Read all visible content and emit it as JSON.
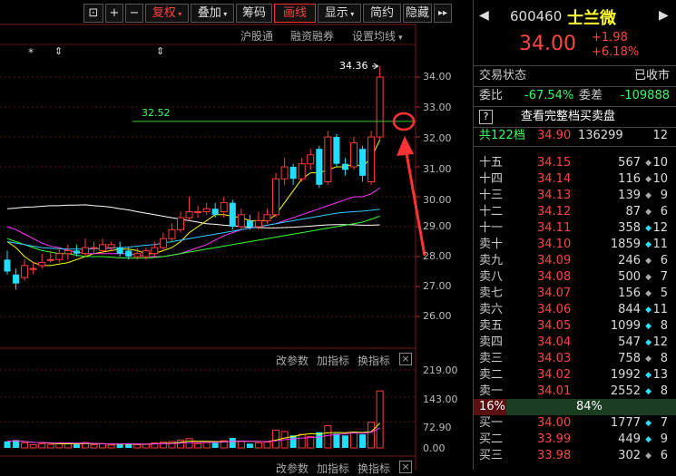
{
  "toolbar": {
    "items": [
      "⊡",
      "+",
      "−",
      "复权",
      "叠加",
      "筹码",
      "画线",
      "显示",
      "简约",
      "隐藏",
      "▸▸"
    ]
  },
  "subtoolbar": {
    "hugu": "沪股通",
    "rongzi": "融资融券",
    "set_ma": "设置均线",
    "caret": "▾"
  },
  "chart": {
    "markers": [
      "*",
      "⇕",
      "⇕"
    ],
    "high_label": "34.36",
    "hline_label": "32.52",
    "price_axis": [
      "34.00",
      "33.00",
      "32.00",
      "31.00",
      "30.00",
      "29.00",
      "28.00",
      "27.00",
      "26.00"
    ],
    "vol_axis": [
      "219.00",
      "143.00",
      "72.90",
      "0.00"
    ],
    "panel_buttons": [
      "改参数",
      "加指标",
      "换指标"
    ],
    "close_icon": "×"
  },
  "chart_data": {
    "type": "candlestick",
    "candles": [
      {
        "o": 27.9,
        "c": 27.5,
        "h": 28.2,
        "l": 27.4,
        "v": 18
      },
      {
        "o": 27.4,
        "c": 27.1,
        "h": 27.6,
        "l": 26.9,
        "v": 22
      },
      {
        "o": 27.3,
        "c": 27.7,
        "h": 27.9,
        "l": 27.2,
        "v": 14
      },
      {
        "o": 27.6,
        "c": 27.6,
        "h": 27.8,
        "l": 27.4,
        "v": 9
      },
      {
        "o": 27.7,
        "c": 27.8,
        "h": 28.1,
        "l": 27.6,
        "v": 12
      },
      {
        "o": 27.9,
        "c": 27.9,
        "h": 28.2,
        "l": 27.8,
        "v": 10
      },
      {
        "o": 27.9,
        "c": 28.1,
        "h": 28.3,
        "l": 27.8,
        "v": 14
      },
      {
        "o": 28.1,
        "c": 28.2,
        "h": 28.4,
        "l": 27.9,
        "v": 12
      },
      {
        "o": 28.2,
        "c": 28.1,
        "h": 28.4,
        "l": 28.0,
        "v": 10
      },
      {
        "o": 28.1,
        "c": 28.3,
        "h": 28.6,
        "l": 28.0,
        "v": 15
      },
      {
        "o": 28.3,
        "c": 28.3,
        "h": 28.5,
        "l": 28.1,
        "v": 9
      },
      {
        "o": 28.2,
        "c": 28.4,
        "h": 28.6,
        "l": 28.1,
        "v": 12
      },
      {
        "o": 28.3,
        "c": 28.4,
        "h": 28.5,
        "l": 28.2,
        "v": 8
      },
      {
        "o": 28.3,
        "c": 28.1,
        "h": 28.5,
        "l": 28.0,
        "v": 11
      },
      {
        "o": 28.2,
        "c": 28.0,
        "h": 28.3,
        "l": 27.9,
        "v": 13
      },
      {
        "o": 28.0,
        "c": 28.1,
        "h": 28.3,
        "l": 27.9,
        "v": 9
      },
      {
        "o": 28.0,
        "c": 28.2,
        "h": 28.3,
        "l": 27.9,
        "v": 10
      },
      {
        "o": 28.1,
        "c": 28.3,
        "h": 28.5,
        "l": 28.0,
        "v": 14
      },
      {
        "o": 28.3,
        "c": 28.6,
        "h": 28.8,
        "l": 28.2,
        "v": 16
      },
      {
        "o": 28.6,
        "c": 28.9,
        "h": 29.1,
        "l": 28.5,
        "v": 18
      },
      {
        "o": 28.9,
        "c": 29.3,
        "h": 29.5,
        "l": 28.8,
        "v": 22
      },
      {
        "o": 29.3,
        "c": 29.5,
        "h": 30.0,
        "l": 29.2,
        "v": 26
      },
      {
        "o": 29.5,
        "c": 29.5,
        "h": 29.7,
        "l": 29.3,
        "v": 12
      },
      {
        "o": 29.5,
        "c": 29.6,
        "h": 29.8,
        "l": 29.4,
        "v": 15
      },
      {
        "o": 29.6,
        "c": 29.4,
        "h": 29.8,
        "l": 29.3,
        "v": 14
      },
      {
        "o": 29.5,
        "c": 29.8,
        "h": 30.0,
        "l": 29.3,
        "v": 20
      },
      {
        "o": 29.8,
        "c": 29.0,
        "h": 29.9,
        "l": 28.9,
        "v": 28
      },
      {
        "o": 29.0,
        "c": 29.4,
        "h": 29.6,
        "l": 28.9,
        "v": 18
      },
      {
        "o": 29.2,
        "c": 29.0,
        "h": 29.4,
        "l": 28.9,
        "v": 12
      },
      {
        "o": 29.0,
        "c": 29.2,
        "h": 29.5,
        "l": 28.9,
        "v": 14
      },
      {
        "o": 29.2,
        "c": 29.4,
        "h": 29.6,
        "l": 29.1,
        "v": 16
      },
      {
        "o": 29.4,
        "c": 30.6,
        "h": 30.8,
        "l": 29.3,
        "v": 50
      },
      {
        "o": 30.6,
        "c": 31.0,
        "h": 31.3,
        "l": 30.4,
        "v": 46
      },
      {
        "o": 31.0,
        "c": 30.6,
        "h": 31.1,
        "l": 30.4,
        "v": 35
      },
      {
        "o": 30.6,
        "c": 31.1,
        "h": 31.3,
        "l": 30.5,
        "v": 38
      },
      {
        "o": 31.1,
        "c": 31.4,
        "h": 31.6,
        "l": 30.9,
        "v": 32
      },
      {
        "o": 31.6,
        "c": 30.4,
        "h": 31.7,
        "l": 30.3,
        "v": 44
      },
      {
        "o": 30.5,
        "c": 32.0,
        "h": 32.2,
        "l": 30.4,
        "v": 62
      },
      {
        "o": 32.0,
        "c": 31.1,
        "h": 32.1,
        "l": 31.0,
        "v": 40
      },
      {
        "o": 31.1,
        "c": 30.9,
        "h": 31.3,
        "l": 30.7,
        "v": 35
      },
      {
        "o": 31.0,
        "c": 31.8,
        "h": 32.0,
        "l": 30.9,
        "v": 42
      },
      {
        "o": 31.6,
        "c": 30.7,
        "h": 31.7,
        "l": 30.5,
        "v": 38
      },
      {
        "o": 30.5,
        "c": 32.0,
        "h": 32.2,
        "l": 30.4,
        "v": 72
      },
      {
        "o": 32.0,
        "c": 34.0,
        "h": 34.36,
        "l": 31.9,
        "v": 160
      }
    ],
    "ma_lines": [
      {
        "color": "#ffffff",
        "values": [
          29.6,
          29.62,
          29.65,
          29.66,
          29.68,
          29.7,
          29.7,
          29.72,
          29.72,
          29.73,
          29.7,
          29.68,
          29.65,
          29.6,
          29.56,
          29.5,
          29.45,
          29.4,
          29.35,
          29.3,
          29.25,
          29.2,
          29.15,
          29.1,
          29.08,
          29.05,
          29.03,
          29.0,
          28.98,
          28.97,
          28.96,
          28.96,
          28.97,
          28.98,
          29.0,
          29.02,
          29.04,
          29.06,
          29.07,
          29.07,
          29.06,
          29.05,
          29.05,
          29.06
        ]
      },
      {
        "color": "#ffff00",
        "values": [
          28.5,
          28.3,
          28.0,
          27.8,
          27.7,
          27.7,
          27.75,
          27.8,
          27.9,
          28.0,
          28.1,
          28.15,
          28.2,
          28.25,
          28.25,
          28.2,
          28.1,
          28.1,
          28.2,
          28.3,
          28.5,
          28.8,
          29.0,
          29.2,
          29.4,
          29.4,
          29.35,
          29.3,
          29.2,
          29.2,
          29.2,
          29.4,
          29.8,
          30.2,
          30.6,
          30.8,
          30.8,
          30.9,
          31.0,
          31.0,
          31.1,
          31.0,
          31.3,
          31.9
        ]
      },
      {
        "color": "#ff33ff",
        "values": [
          29.0,
          28.9,
          28.75,
          28.6,
          28.45,
          28.35,
          28.3,
          28.2,
          28.15,
          28.1,
          28.1,
          28.1,
          28.1,
          28.1,
          28.1,
          28.05,
          28.0,
          28.0,
          28.0,
          28.05,
          28.1,
          28.2,
          28.3,
          28.4,
          28.55,
          28.7,
          28.8,
          28.9,
          28.95,
          29.0,
          29.05,
          29.1,
          29.2,
          29.3,
          29.4,
          29.5,
          29.6,
          29.7,
          29.8,
          29.9,
          30.0,
          30.0,
          30.1,
          30.3
        ]
      },
      {
        "color": "#33ff33",
        "values": [
          28.6,
          28.5,
          28.4,
          28.3,
          28.2,
          28.15,
          28.1,
          28.1,
          28.05,
          28.0,
          28.0,
          28.0,
          27.98,
          27.96,
          27.95,
          27.95,
          27.95,
          27.97,
          28.0,
          28.05,
          28.1,
          28.15,
          28.2,
          28.25,
          28.3,
          28.35,
          28.4,
          28.45,
          28.5,
          28.55,
          28.6,
          28.65,
          28.7,
          28.75,
          28.8,
          28.85,
          28.9,
          28.95,
          29.0,
          29.05,
          29.1,
          29.15,
          29.25,
          29.35
        ]
      },
      {
        "color": "#33ccff",
        "values": [
          28.5,
          28.45,
          28.4,
          28.35,
          28.3,
          28.28,
          28.26,
          28.25,
          28.25,
          28.25,
          28.26,
          28.27,
          28.28,
          28.3,
          28.32,
          28.35,
          28.38,
          28.4,
          28.45,
          28.5,
          28.55,
          28.6,
          28.65,
          28.7,
          28.75,
          28.8,
          28.85,
          28.9,
          28.95,
          29.0,
          29.05,
          29.1,
          29.15,
          29.2,
          29.25,
          29.3,
          29.35,
          29.4,
          29.45,
          29.48,
          29.5,
          29.52,
          29.55,
          29.58
        ]
      }
    ],
    "price_range": [
      25.5,
      34.6
    ],
    "volume_range": [
      0,
      219
    ]
  },
  "quote": {
    "code": "600460",
    "name": "士兰微",
    "price": "34.00",
    "change": "+1.98",
    "change_pct": "+6.18%",
    "status_label": "交易状态",
    "status_value": "已收市",
    "weibi_label": "委比",
    "weibi_value": "-67.54%",
    "weicha_label": "委差",
    "weicha_value": "-109888",
    "full_book_q": "?",
    "full_book_label": "查看完整档买卖盘",
    "total_levels": "共122档",
    "total_price": "34.90",
    "total_vol": "136299",
    "total_cnt": "12",
    "asks": [
      {
        "label": "十五",
        "price": "34.15",
        "vol": "567",
        "dot": "◆",
        "cnt": "10",
        "dotcolor": "#aaaaaa"
      },
      {
        "label": "十四",
        "price": "34.14",
        "vol": "116",
        "dot": "◆",
        "cnt": "10",
        "dotcolor": "#aaaaaa"
      },
      {
        "label": "十三",
        "price": "34.13",
        "vol": "139",
        "dot": "◆",
        "cnt": "9",
        "dotcolor": "#aaaaaa"
      },
      {
        "label": "十二",
        "price": "34.12",
        "vol": "87",
        "dot": "◆",
        "cnt": "6",
        "dotcolor": "#aaaaaa"
      },
      {
        "label": "十一",
        "price": "34.11",
        "vol": "358",
        "dot": "◆",
        "cnt": "12",
        "dotcolor": "#33ddff"
      },
      {
        "label": "卖十",
        "price": "34.10",
        "vol": "1859",
        "dot": "◆",
        "cnt": "11",
        "dotcolor": "#33ddff"
      },
      {
        "label": "卖九",
        "price": "34.09",
        "vol": "246",
        "dot": "◆",
        "cnt": "6",
        "dotcolor": "#aaaaaa"
      },
      {
        "label": "卖八",
        "price": "34.08",
        "vol": "500",
        "dot": "◆",
        "cnt": "7",
        "dotcolor": "#aaaaaa"
      },
      {
        "label": "卖七",
        "price": "34.07",
        "vol": "156",
        "dot": "◆",
        "cnt": "5",
        "dotcolor": "#aaaaaa"
      },
      {
        "label": "卖六",
        "price": "34.06",
        "vol": "844",
        "dot": "◆",
        "cnt": "11",
        "dotcolor": "#33ddff"
      },
      {
        "label": "卖五",
        "price": "34.05",
        "vol": "1099",
        "dot": "◆",
        "cnt": "8",
        "dotcolor": "#33ddff"
      },
      {
        "label": "卖四",
        "price": "34.04",
        "vol": "547",
        "dot": "◆",
        "cnt": "12",
        "dotcolor": "#33ddff"
      },
      {
        "label": "卖三",
        "price": "34.03",
        "vol": "758",
        "dot": "◆",
        "cnt": "8",
        "dotcolor": "#aaaaaa"
      },
      {
        "label": "卖二",
        "price": "34.02",
        "vol": "1992",
        "dot": "◆",
        "cnt": "13",
        "dotcolor": "#33ddff"
      },
      {
        "label": "卖一",
        "price": "34.01",
        "vol": "2552",
        "dot": "◆",
        "cnt": "8",
        "dotcolor": "#33ddff"
      }
    ],
    "ratio_left": "16%",
    "ratio_right": "84%",
    "ratio_fraction": 0.16,
    "bids": [
      {
        "label": "买一",
        "price": "34.00",
        "vol": "1777",
        "dot": "◆",
        "cnt": "7",
        "dotcolor": "#33ddff"
      },
      {
        "label": "买二",
        "price": "33.99",
        "vol": "449",
        "dot": "◆",
        "cnt": "9",
        "dotcolor": "#33ddff"
      },
      {
        "label": "买三",
        "price": "33.98",
        "vol": "302",
        "dot": "◆",
        "cnt": "6",
        "dotcolor": "#aaaaaa"
      }
    ]
  }
}
